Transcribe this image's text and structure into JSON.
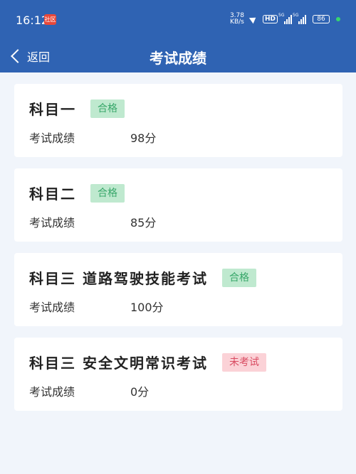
{
  "status": {
    "time": "16:12",
    "badge": "社区",
    "speed_value": "3.78",
    "speed_unit": "KB/s",
    "hd": "HD",
    "net1": "5G",
    "net2": "5G",
    "battery": "86"
  },
  "header": {
    "back_label": "返回",
    "title": "考试成绩"
  },
  "results": [
    {
      "subject": "科目一",
      "status": "合格",
      "score_label": "考试成绩",
      "score": "98分"
    },
    {
      "subject": "科目二",
      "status": "合格",
      "score_label": "考试成绩",
      "score": "85分"
    },
    {
      "subject": "科目三 道路驾驶技能考试",
      "status": "合格",
      "score_label": "考试成绩",
      "score": "100分"
    },
    {
      "subject": "科目三 安全文明常识考试",
      "status": "未考试",
      "score_label": "考试成绩",
      "score": "0分"
    }
  ],
  "colors": {
    "header_bg": "#2f63b3",
    "pass_bg": "#bfe9cf",
    "pass_text": "#38a76a",
    "fail_bg": "#fbd2d7",
    "fail_text": "#d94c62"
  }
}
